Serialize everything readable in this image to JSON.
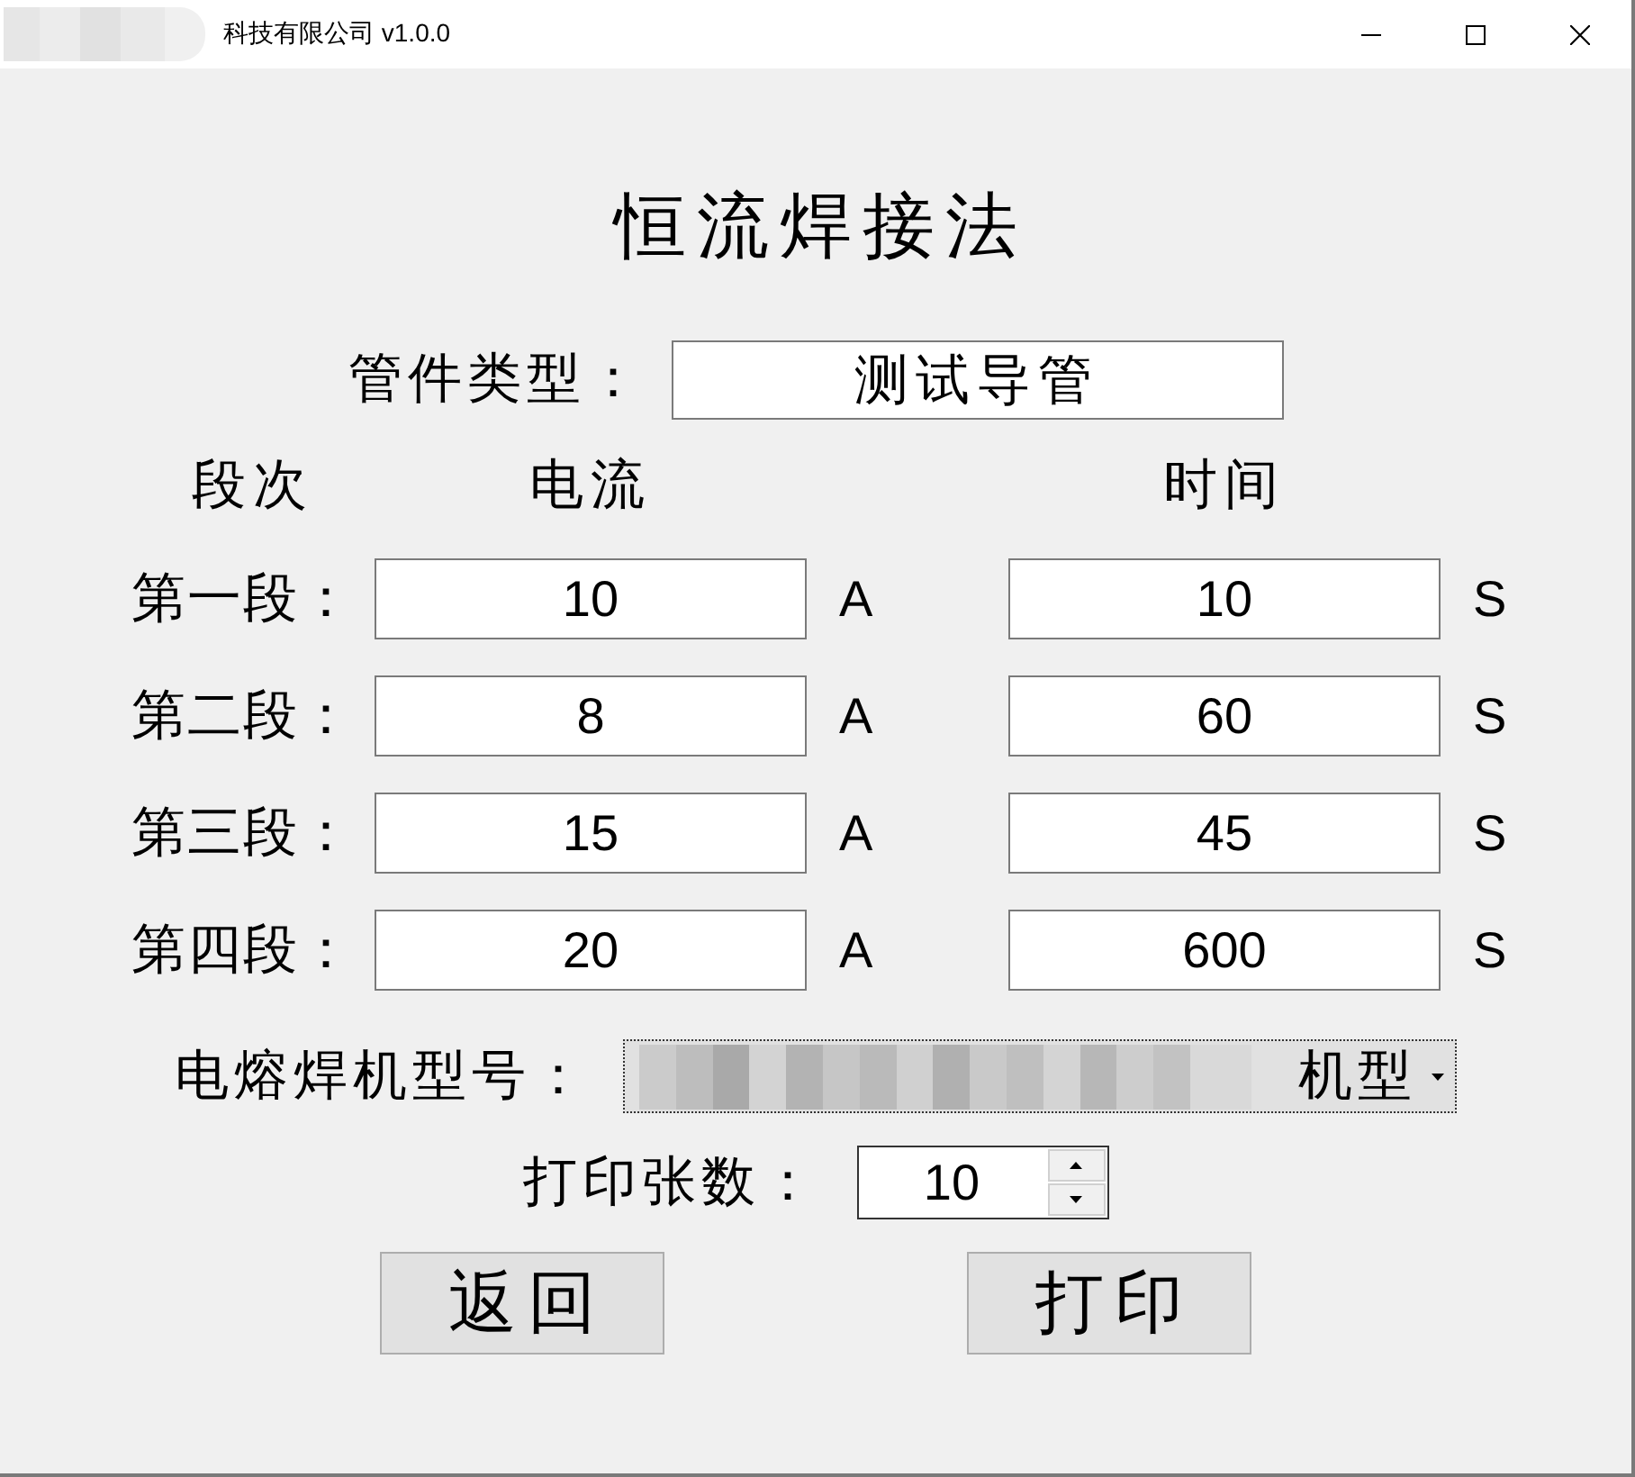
{
  "window": {
    "title": "科技有限公司 v1.0.0"
  },
  "heading": "恒流焊接法",
  "pipe_type": {
    "label": "管件类型：",
    "value": "测试导管"
  },
  "columns": [
    "段次",
    "电流",
    "时间"
  ],
  "stages": [
    {
      "label": "第一段：",
      "current": "10",
      "current_unit": "A",
      "time": "10",
      "time_unit": "S"
    },
    {
      "label": "第二段：",
      "current": "8",
      "current_unit": "A",
      "time": "60",
      "time_unit": "S"
    },
    {
      "label": "第三段：",
      "current": "15",
      "current_unit": "A",
      "time": "45",
      "time_unit": "S"
    },
    {
      "label": "第四段：",
      "current": "20",
      "current_unit": "A",
      "time": "600",
      "time_unit": "S"
    }
  ],
  "machine_model": {
    "label": "电熔焊机型号：",
    "value": "机型",
    "focused": true
  },
  "print_count": {
    "label": "打印张数：",
    "value": "10"
  },
  "buttons": [
    "返回",
    "打印"
  ]
}
